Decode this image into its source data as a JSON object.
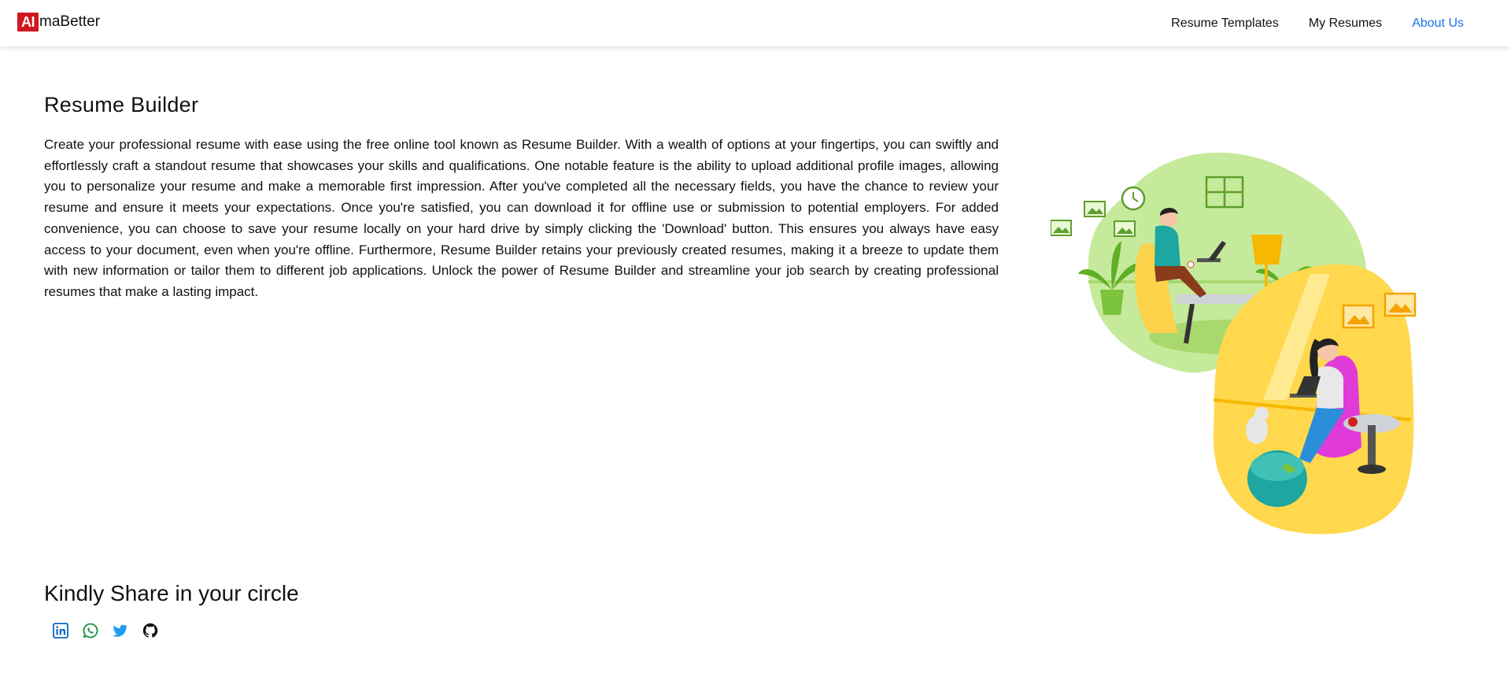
{
  "brand": {
    "badge": "AI",
    "name": "maBetter"
  },
  "nav": {
    "items": [
      {
        "label": "Resume Templates",
        "active": false
      },
      {
        "label": "My Resumes",
        "active": false
      },
      {
        "label": "About Us",
        "active": true
      }
    ]
  },
  "main": {
    "title": "Resume Builder",
    "description": "Create your professional resume with ease using the free online tool known as Resume Builder. With a wealth of options at your fingertips, you can swiftly and effortlessly craft a standout resume that showcases your skills and qualifications. One notable feature is the ability to upload additional profile images, allowing you to personalize your resume and make a memorable first impression. After you've completed all the necessary fields, you have the chance to review your resume and ensure it meets your expectations. Once you're satisfied, you can download it for offline use or submission to potential employers. For added convenience, you can choose to save your resume locally on your hard drive by simply clicking the 'Download' button. This ensures you always have easy access to your document, even when you're offline. Furthermore, Resume Builder retains your previously created resumes, making it a breeze to update them with new information or tailor them to different job applications. Unlock the power of Resume Builder and streamline your job search by creating professional resumes that make a lasting impact."
  },
  "share": {
    "title": "Kindly Share in your circle",
    "icons": [
      "linkedin-icon",
      "whatsapp-icon",
      "twitter-icon",
      "github-icon"
    ]
  },
  "colors": {
    "brand_red": "#d0161f",
    "active_link": "#1a73e8",
    "linkedin": "#0a66c2",
    "whatsapp": "#1e8e3e",
    "twitter": "#1d9bf0",
    "github": "#111111"
  }
}
